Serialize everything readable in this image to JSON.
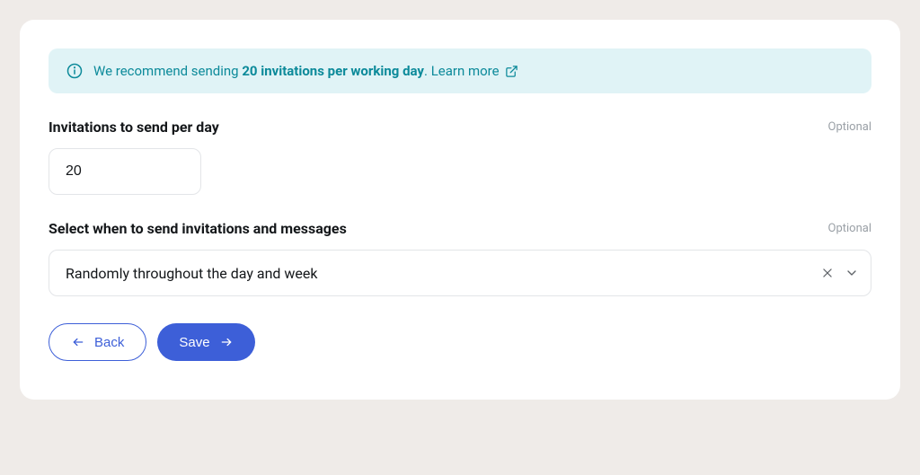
{
  "banner": {
    "prefix": "We recommend sending ",
    "bold": "20 invitations per working day",
    "suffix": ". ",
    "learn_more": "Learn more"
  },
  "field_invites": {
    "label": "Invitations to send per day",
    "optional": "Optional",
    "value": "20"
  },
  "field_schedule": {
    "label": "Select when to send invitations and messages",
    "optional": "Optional",
    "value": "Randomly throughout the day and week"
  },
  "buttons": {
    "back": "Back",
    "save": "Save"
  }
}
